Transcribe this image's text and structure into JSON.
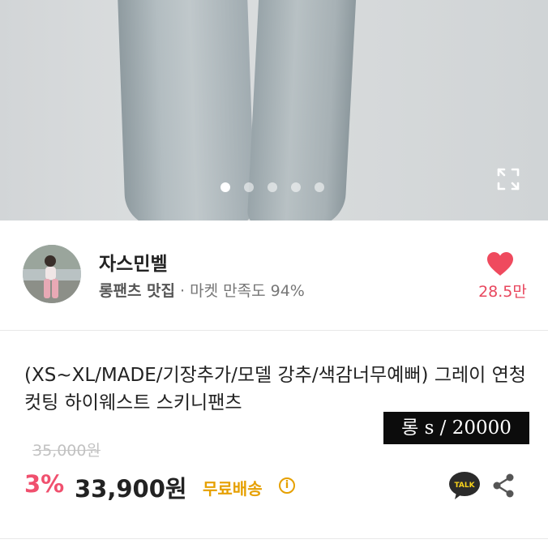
{
  "gallery": {
    "image_label": "product-photo-jeans",
    "slide_count": 5,
    "active_index": 0,
    "expand_icon": "expand-icon"
  },
  "seller": {
    "name": "자스민벨",
    "tagline": "롱팬츠 맛집",
    "separator": " · ",
    "rating_text": "마켓 만족도 94%",
    "like_icon": "heart-icon",
    "like_count": "28.5만",
    "accent_color": "#e8475e"
  },
  "product": {
    "title": "(XS~XL/MADE/기장추가/모델 강추/색감너무예뻐) 그레이 연청 컷팅 하이웨스트 스키니팬츠",
    "overlay_text": "롱 s / 20000",
    "original_price": "35,000원",
    "discount": "3%",
    "price": "33,900원",
    "shipping": "무료배송",
    "discount_color": "#f0506e",
    "shipping_color": "#e6a000"
  },
  "actions": {
    "talk_label": "TALK",
    "talk_icon": "kakaotalk-icon",
    "share_icon": "share-icon"
  }
}
